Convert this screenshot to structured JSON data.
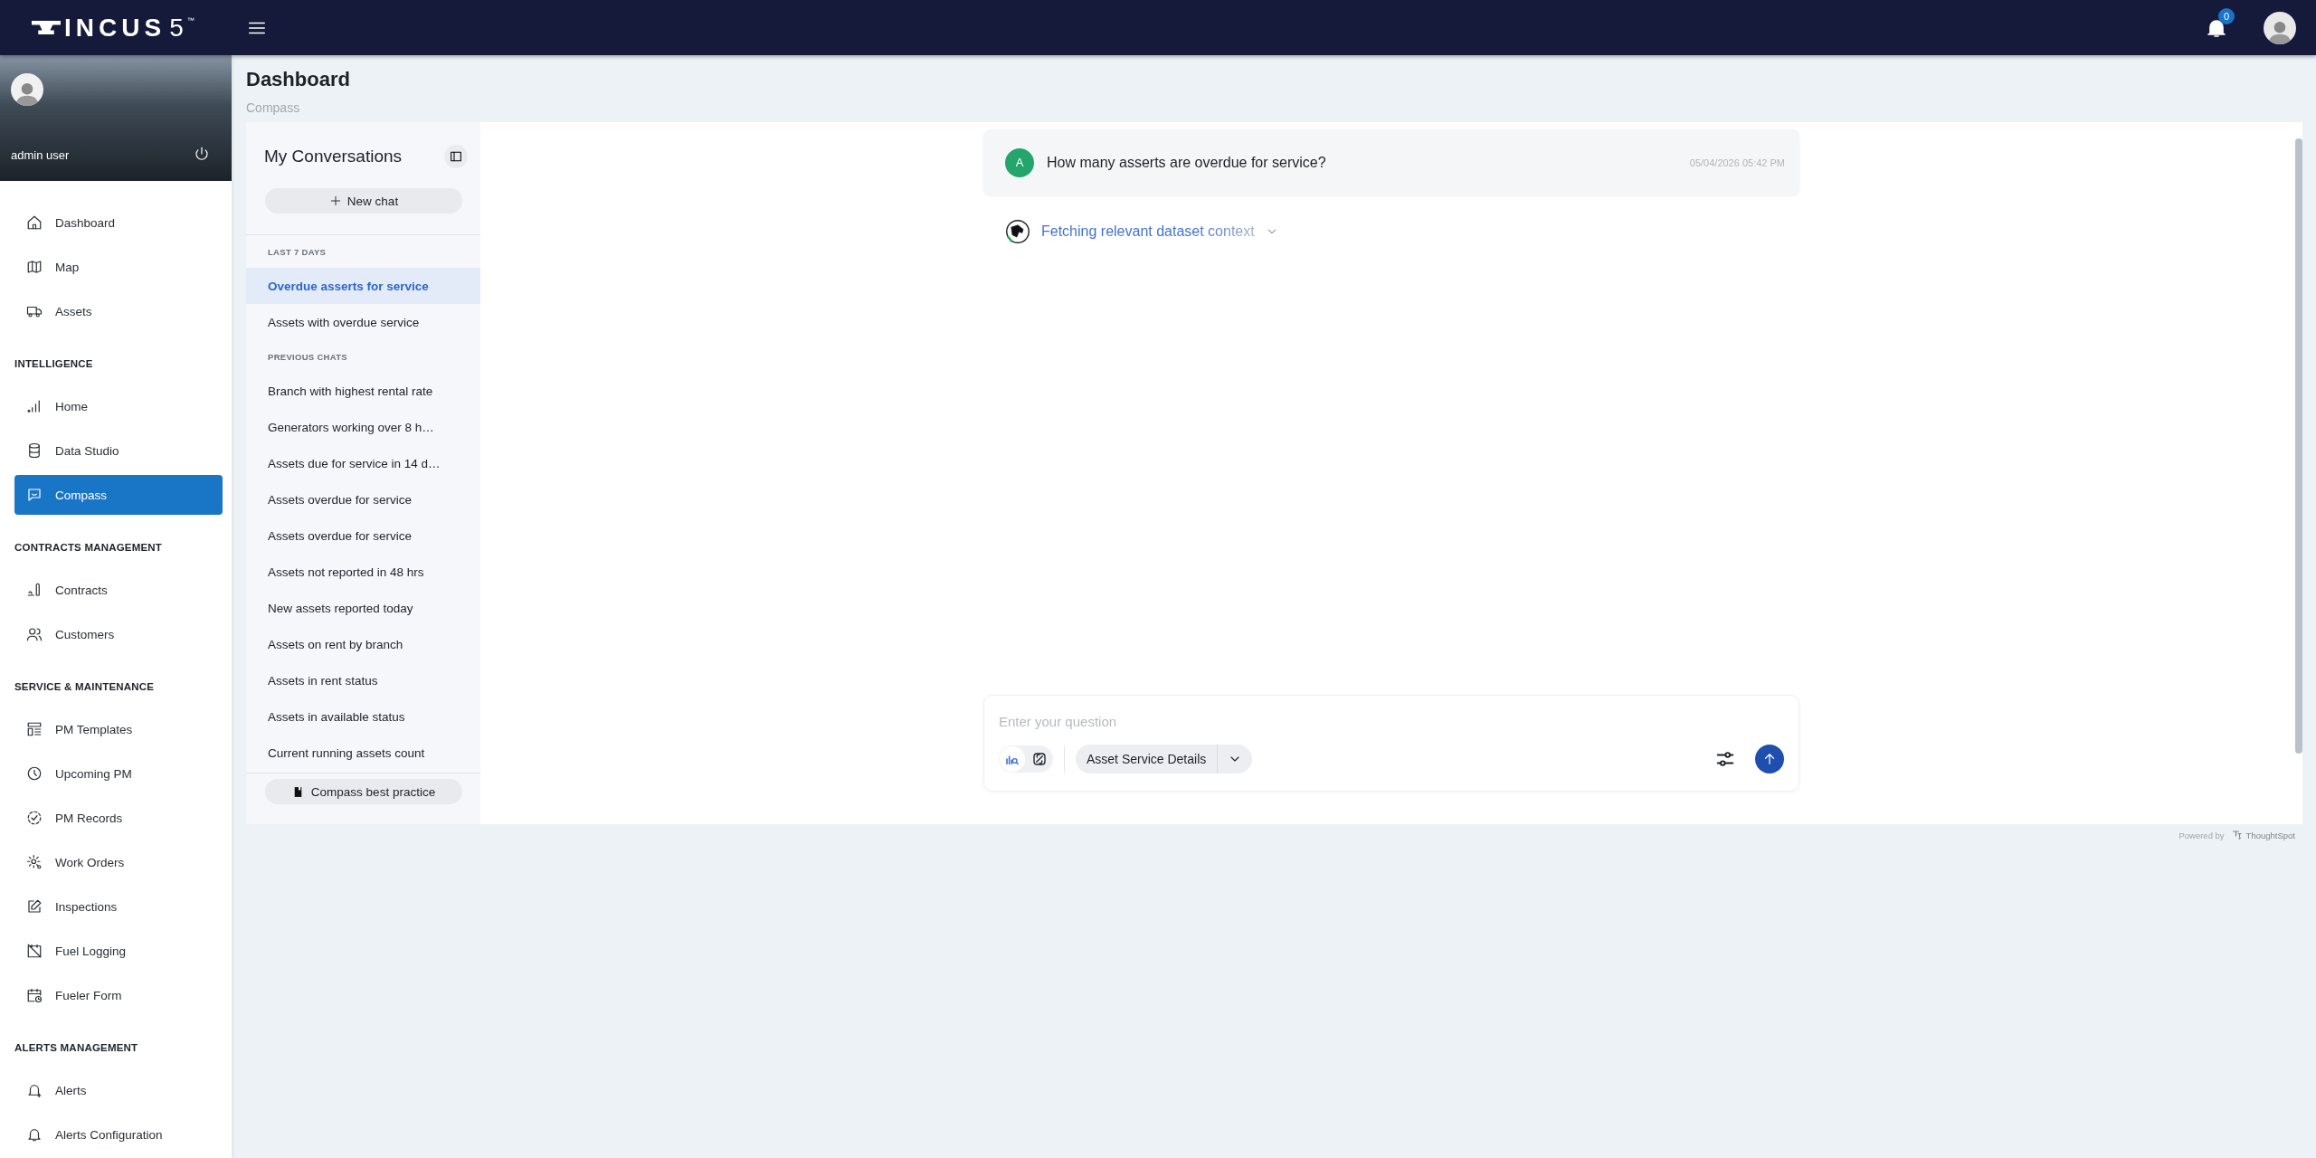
{
  "top_bar": {
    "logo": {
      "name": "INCUS",
      "version": "5",
      "mark": "™"
    },
    "notifications": {
      "count": "0"
    }
  },
  "sidebar": {
    "user": {
      "name": "admin user"
    },
    "sections": [
      {
        "items": [
          {
            "label": "Dashboard",
            "selected": false
          },
          {
            "label": "Map",
            "selected": false
          },
          {
            "label": "Assets",
            "selected": false
          }
        ]
      },
      {
        "heading": "INTELLIGENCE",
        "items": [
          {
            "label": "Home",
            "selected": false
          },
          {
            "label": "Data Studio",
            "selected": false
          },
          {
            "label": "Compass",
            "selected": true
          }
        ]
      },
      {
        "heading": "CONTRACTS MANAGEMENT",
        "items": [
          {
            "label": "Contracts",
            "selected": false
          },
          {
            "label": "Customers",
            "selected": false
          }
        ]
      },
      {
        "heading": "SERVICE & MAINTENANCE",
        "items": [
          {
            "label": "PM Templates",
            "selected": false
          },
          {
            "label": "Upcoming PM",
            "selected": false
          },
          {
            "label": "PM Records",
            "selected": false
          },
          {
            "label": "Work Orders",
            "selected": false
          },
          {
            "label": "Inspections",
            "selected": false
          },
          {
            "label": "Fuel Logging",
            "selected": false
          },
          {
            "label": "Fueler Form",
            "selected": false
          }
        ]
      },
      {
        "heading": "ALERTS MANAGEMENT",
        "items": [
          {
            "label": "Alerts",
            "selected": false
          },
          {
            "label": "Alerts Configuration",
            "selected": false
          }
        ]
      }
    ]
  },
  "page": {
    "title": "Dashboard",
    "breadcrumb": "Compass"
  },
  "conversations": {
    "title": "My Conversations",
    "new_chat": "New chat",
    "groups": [
      {
        "heading": "LAST 7 DAYS",
        "items": [
          {
            "label": "Overdue asserts for service",
            "selected": true
          },
          {
            "label": "Assets with overdue service",
            "selected": false
          }
        ]
      },
      {
        "heading": "PREVIOUS CHATS",
        "items": [
          {
            "label": "Branch with highest rental rate",
            "selected": false
          },
          {
            "label": "Generators working over 8 h…",
            "selected": false
          },
          {
            "label": "Assets due for service in 14 d…",
            "selected": false
          },
          {
            "label": "Assets overdue for service",
            "selected": false
          },
          {
            "label": "Assets overdue for service",
            "selected": false
          },
          {
            "label": "Assets not reported in 48 hrs",
            "selected": false
          },
          {
            "label": "New assets reported today",
            "selected": false
          },
          {
            "label": "Assets on rent by branch",
            "selected": false
          },
          {
            "label": "Assets in rent status",
            "selected": false
          },
          {
            "label": "Assets in available status",
            "selected": false
          },
          {
            "label": "Current running assets count",
            "selected": false
          }
        ]
      }
    ],
    "best_practice": "Compass best practice"
  },
  "chat": {
    "messages": [
      {
        "avatar": "A",
        "text": "How many asserts are overdue for service?",
        "time": "05/04/2026 05:42 PM"
      }
    ],
    "status": {
      "text": "Fetching relevant dataset context"
    },
    "input": {
      "placeholder": "Enter your question",
      "modes": [
        {
          "selected": true
        },
        {
          "selected": false
        }
      ],
      "dataset": "Asset Service Details"
    }
  },
  "footer": {
    "powered_by": "Powered by",
    "brand": "ThoughtSpot"
  }
}
